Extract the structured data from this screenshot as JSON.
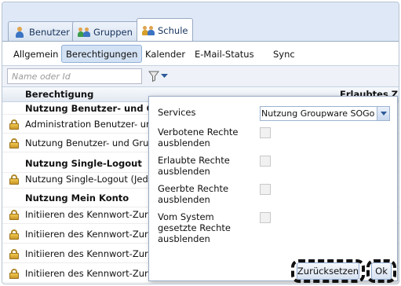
{
  "tabs": [
    {
      "label": "Benutzer",
      "icon": "user-icon"
    },
    {
      "label": "Gruppen",
      "icon": "group-icon"
    },
    {
      "label": "Schule",
      "icon": "school-icon",
      "active": true
    }
  ],
  "subtabs": [
    {
      "label": "Allgemein"
    },
    {
      "label": "Berechtigungen",
      "active": true
    },
    {
      "label": "Kalender"
    },
    {
      "label": "E-Mail-Status"
    },
    {
      "label": "Sync"
    }
  ],
  "filter": {
    "search_placeholder": "Name oder Id",
    "filter_icon": "funnel-icon"
  },
  "grid": {
    "columns": {
      "permission": "Berechtigung",
      "allowed": "Erlaubtes Ziel"
    },
    "rows": [
      {
        "text": "Nutzung Benutzer- und Gruppen",
        "group": true
      },
      {
        "text": "Administration Benutzer- und Gruppen",
        "locked": true
      },
      {
        "text": "Nutzung Benutzer- und Gruppen",
        "locked": true
      },
      {
        "text": "Nutzung Single-Logout",
        "group": true
      },
      {
        "text": "Nutzung Single-Logout (Jedes Ziel)",
        "locked": true
      },
      {
        "text": "Nutzung Mein Konto",
        "group": true
      },
      {
        "text": "Initiieren des Kennwort-Zurücksetzens",
        "locked": true
      },
      {
        "text": "Initiieren des Kennwort-Zurücksetzens",
        "locked": true
      },
      {
        "text": "Initiieren des Kennwort-Zurücksetzens",
        "locked": true
      },
      {
        "text": "Initiieren des Kennwort-Zurücksetzens",
        "locked": true
      }
    ]
  },
  "popup": {
    "services_label": "Services",
    "services_value": "Nutzung Groupware SOGo",
    "options": [
      {
        "label": "Verbotene Rechte ausblenden",
        "checked": false
      },
      {
        "label": "Erlaubte Rechte ausblenden",
        "checked": false
      },
      {
        "label": "Geerbte Rechte ausblenden",
        "checked": false
      },
      {
        "label": "Vom System gesetzte Rechte ausblenden",
        "checked": false
      }
    ],
    "reset_label": "Zurücksetzen",
    "ok_label": "Ok"
  },
  "colors": {
    "accent": "#15325c",
    "panel_bg": "#dfe8f6",
    "active_subtab": "#d3e1f4"
  }
}
